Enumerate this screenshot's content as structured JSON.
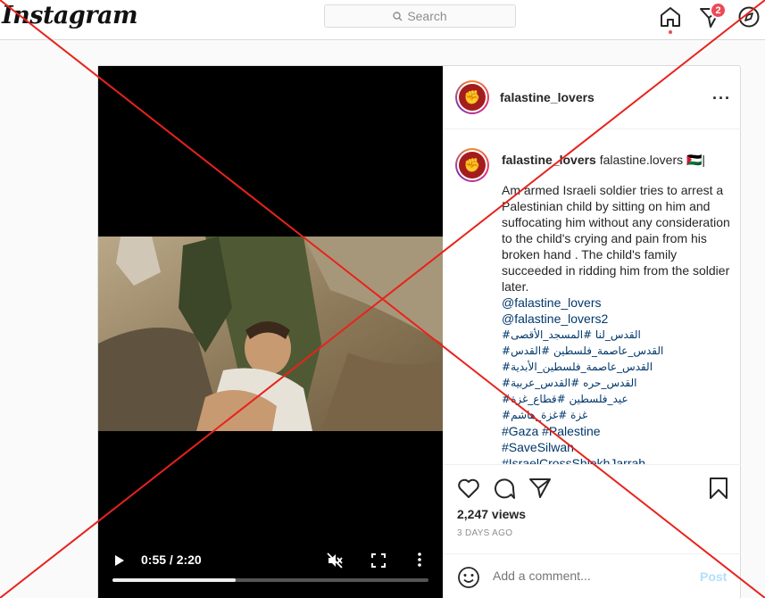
{
  "nav": {
    "logo": "Instagram",
    "search_placeholder": "Search",
    "icons": [
      "home-icon",
      "direct-icon",
      "explore-icon"
    ],
    "direct_badge": "2"
  },
  "post": {
    "username": "falastine_lovers",
    "video": {
      "time": "0:55 / 2:20",
      "progress": 0.39
    },
    "caption": {
      "username": "falastine_lovers",
      "profile_name": "falastine.lovers 🇵🇸|",
      "text": "Am armed Israeli soldier tries to arrest a Palestinian child by sitting on him and suffocating him without any consideration to the child's crying and pain from his broken hand . The child's family succeeded in ridding him from the soldier later.",
      "mentions": [
        "@falastine_lovers",
        "@falastine_lovers2"
      ],
      "arabic_tags": [
        "#القدس_لنا #المسجد_الأقصى",
        "#القدس_عاصمة_فلسطين #القدس",
        "#القدس_عاصمة_فلسطين_الأبدية",
        "#القدس_حره #القدس_عربية",
        "#عيد_فلسطين #قطاع_غزة",
        "#غزة #غزة_هاشم"
      ],
      "tags": [
        "#Gaza #Palestine",
        "#SaveSilwan",
        "#IsraelCrossShiekhJarrah"
      ]
    },
    "views": "2,247 views",
    "posted": "3 DAYS AGO",
    "comment_placeholder": "Add a comment...",
    "post_label": "Post"
  },
  "colors": {
    "overlay_x": "#e8231b",
    "link": "#00376b",
    "badge": "#ed4956"
  }
}
